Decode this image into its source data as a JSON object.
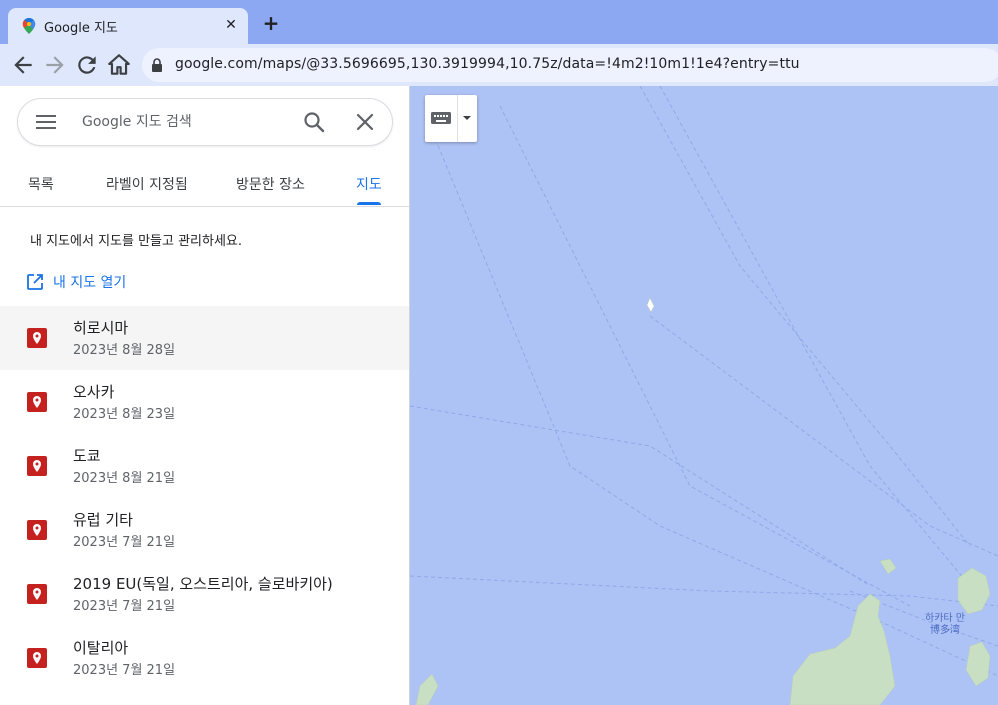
{
  "browser": {
    "tab_title": "Google 지도",
    "tab_close": "✕",
    "new_tab": "+",
    "url": "google.com/maps/@33.5696695,130.3919994,10.75z/data=!4m2!10m1!1e4?entry=ttu"
  },
  "search": {
    "placeholder": "Google 지도 검색"
  },
  "tabs": [
    {
      "label": "목록",
      "active": false
    },
    {
      "label": "라벨이 지정됨",
      "active": false
    },
    {
      "label": "방문한 장소",
      "active": false
    },
    {
      "label": "지도",
      "active": true
    }
  ],
  "description": "내 지도에서 지도를 만들고 관리하세요.",
  "open_my_maps": "내 지도 열기",
  "maps": [
    {
      "title": "히로시마",
      "date": "2023년 8월 28일"
    },
    {
      "title": "오사카",
      "date": "2023년 8월 23일"
    },
    {
      "title": "도쿄",
      "date": "2023년 8월 21일"
    },
    {
      "title": "유럽 기타",
      "date": "2023년 7월 21일"
    },
    {
      "title": "2019 EU(독일, 오스트리아, 슬로바키아)",
      "date": "2023년 7월 21일"
    },
    {
      "title": "이탈리아",
      "date": "2023년 7월 21일"
    }
  ],
  "map_labels": {
    "bay_ko": "하카타 만",
    "bay_jp": "博多湾"
  },
  "colors": {
    "accent": "#1a73e8",
    "pin": "#c5221f",
    "water": "#aec3f5",
    "land": "#c8dfc4",
    "tabbar": "#8ca8f3"
  }
}
